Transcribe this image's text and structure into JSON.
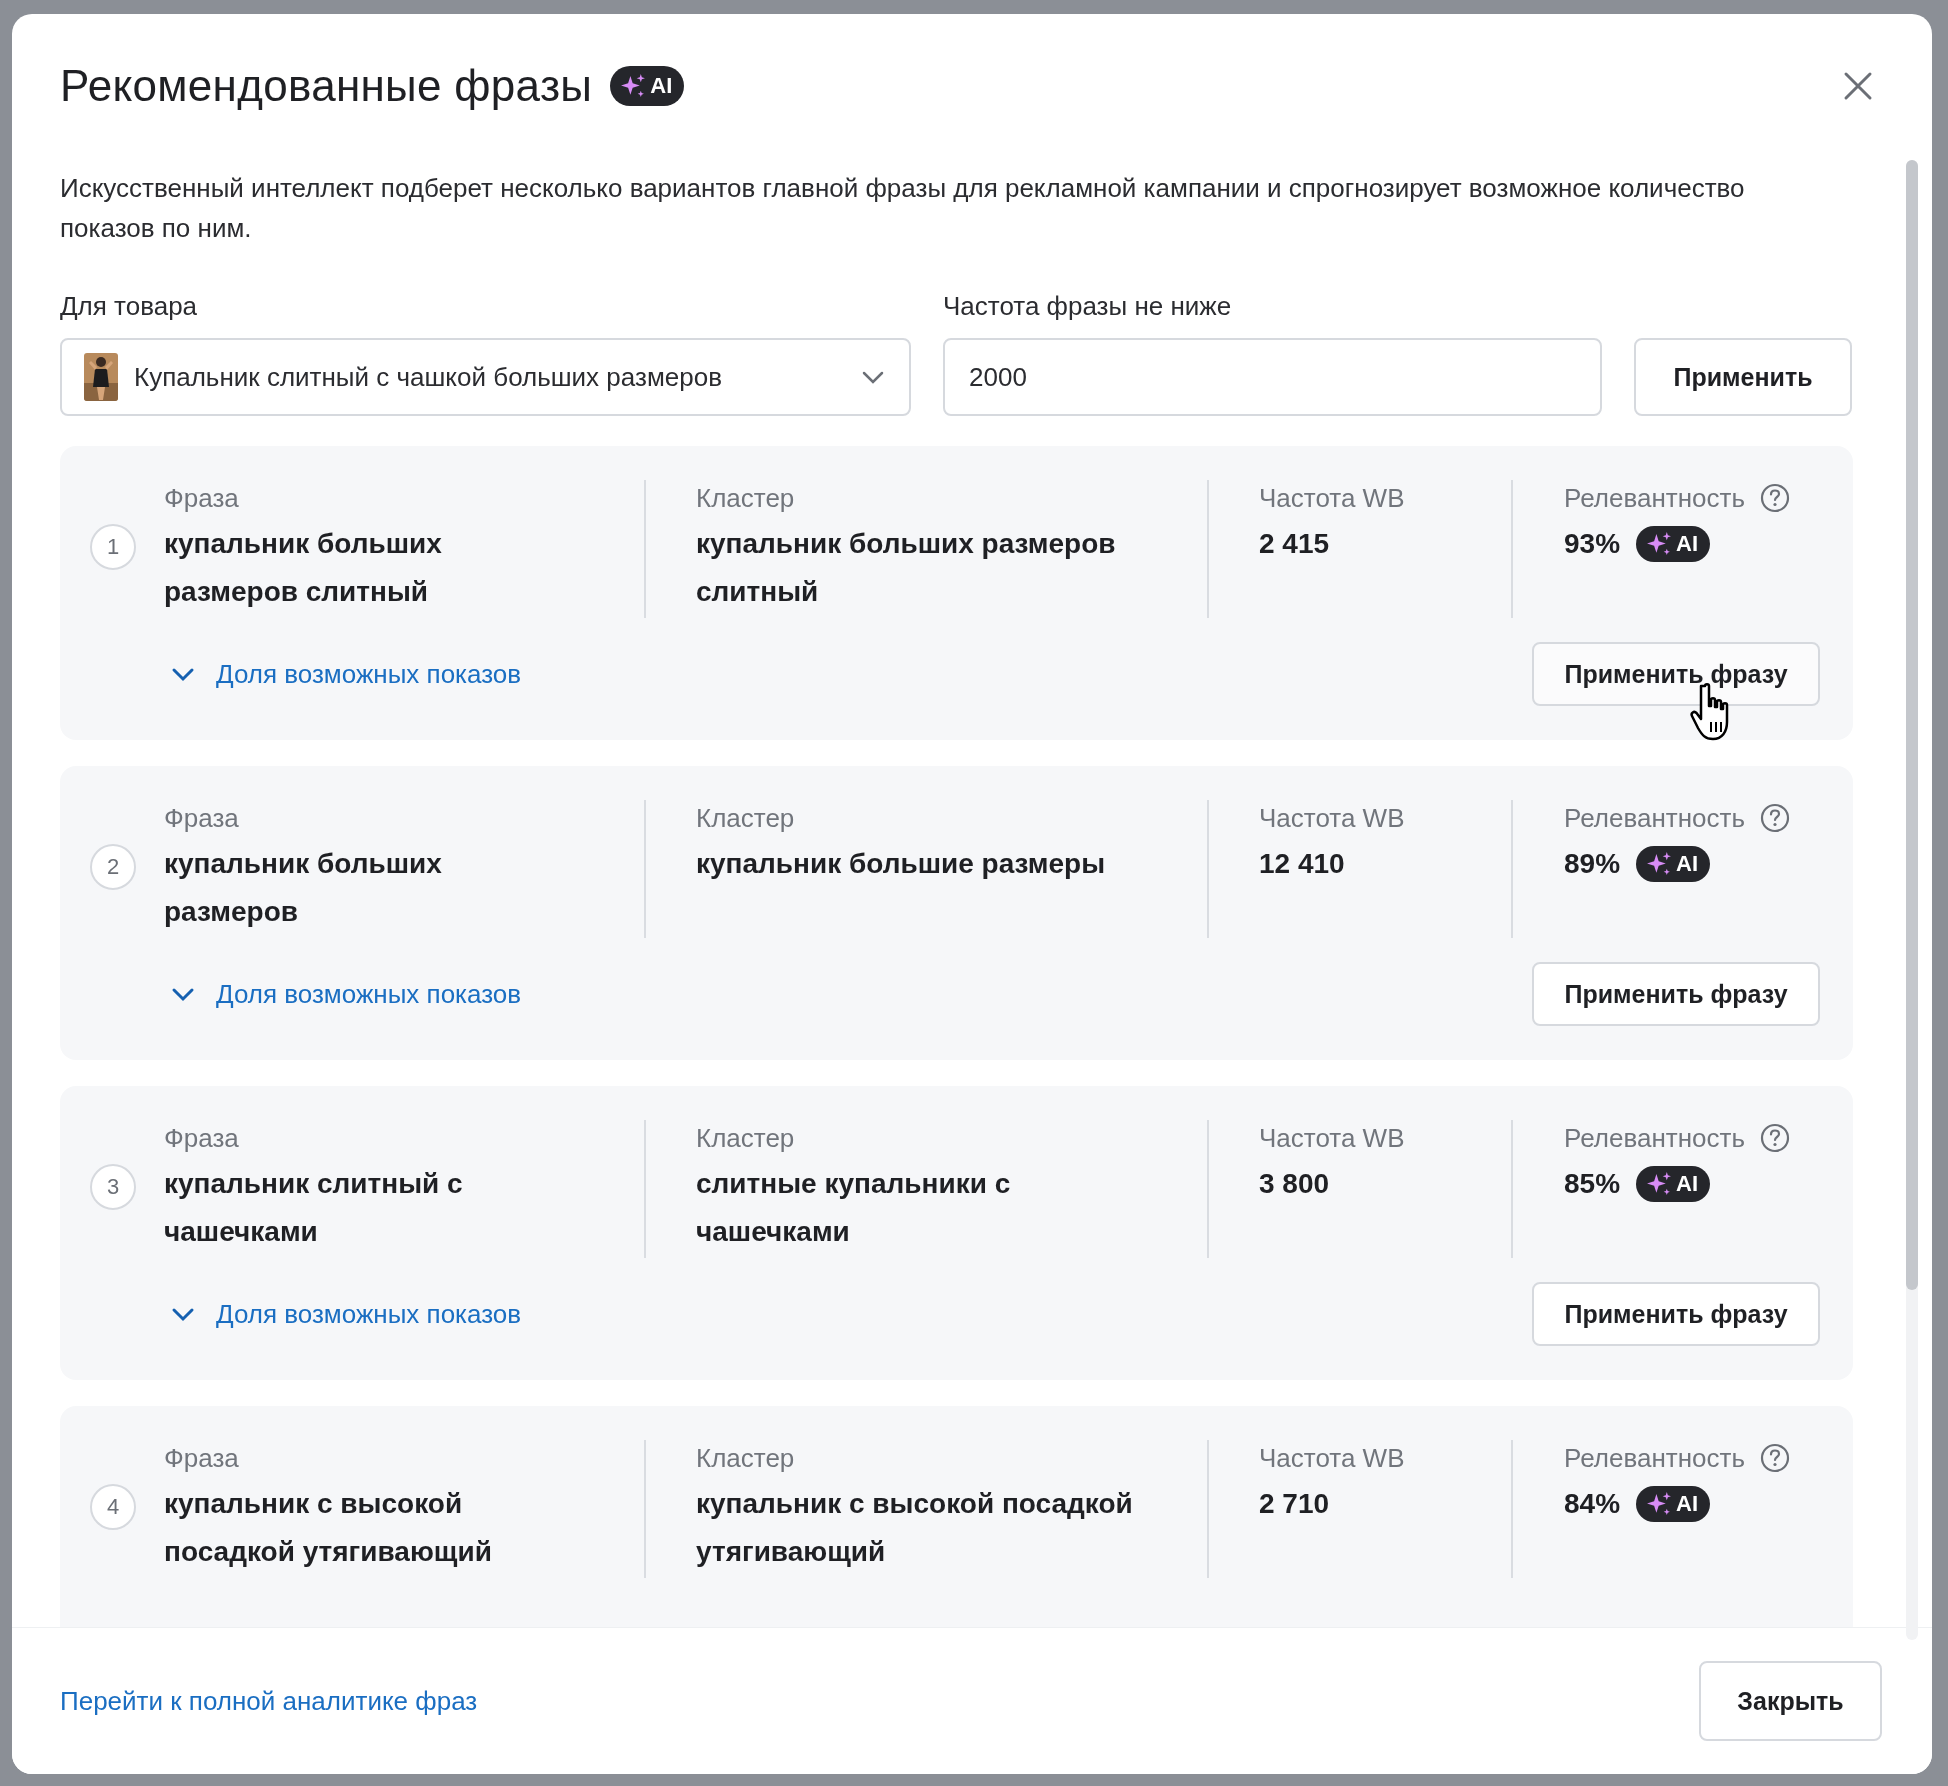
{
  "dialog": {
    "title": "Рекомендованные фразы",
    "title_badge": "AI",
    "description": "Искусственный интеллект подберет несколько вариантов главной фразы для рекламной кампании и спрогнозирует возможное количество показов по ним.",
    "product_label": "Для товара",
    "product_value": "Купальник слитный с чашкой больших размеров",
    "frequency_label": "Частота фразы не ниже",
    "frequency_value": "2000",
    "apply_button": "Применить"
  },
  "phrases": [
    {
      "number": "1",
      "phrase_label": "Фраза",
      "phrase": "купальник больших размеров слитный",
      "cluster_label": "Кластер",
      "cluster": "купальник больших размеров слитный",
      "frequency_label": "Частота WB",
      "frequency": "2 415",
      "relevance_label": "Релевантность",
      "relevance": "93%",
      "relevance_badge": "AI",
      "share_toggle": "Доля возможных показов",
      "expanded": false,
      "apply_button": "Применить фразу",
      "hovered": true
    },
    {
      "number": "2",
      "phrase_label": "Фраза",
      "phrase": "купальник больших размеров",
      "cluster_label": "Кластер",
      "cluster": "купальник большие размеры",
      "frequency_label": "Частота WB",
      "frequency": "12 410",
      "relevance_label": "Релевантность",
      "relevance": "89%",
      "relevance_badge": "AI",
      "share_toggle": "Доля возможных показов",
      "expanded": false,
      "apply_button": "Применить фразу",
      "hovered": false
    },
    {
      "number": "3",
      "phrase_label": "Фраза",
      "phrase": "купальник слитный с чашечками",
      "cluster_label": "Кластер",
      "cluster": "слитные купальники с чашечками",
      "frequency_label": "Частота WB",
      "frequency": "3 800",
      "relevance_label": "Релевантность",
      "relevance": "85%",
      "relevance_badge": "AI",
      "share_toggle": "Доля возможных показов",
      "expanded": false,
      "apply_button": "Применить фразу",
      "hovered": false
    },
    {
      "number": "4",
      "phrase_label": "Фраза",
      "phrase": "купальник с высокой посадкой утягивающий",
      "cluster_label": "Кластер",
      "cluster": "купальник с высокой посадкой утягивающий",
      "frequency_label": "Частота WB",
      "frequency": "2 710",
      "relevance_label": "Релевантность",
      "relevance": "84%",
      "relevance_badge": "AI"
    }
  ],
  "footer": {
    "analytics_link": "Перейти к полной аналитике фраз",
    "close_button": "Закрыть"
  }
}
